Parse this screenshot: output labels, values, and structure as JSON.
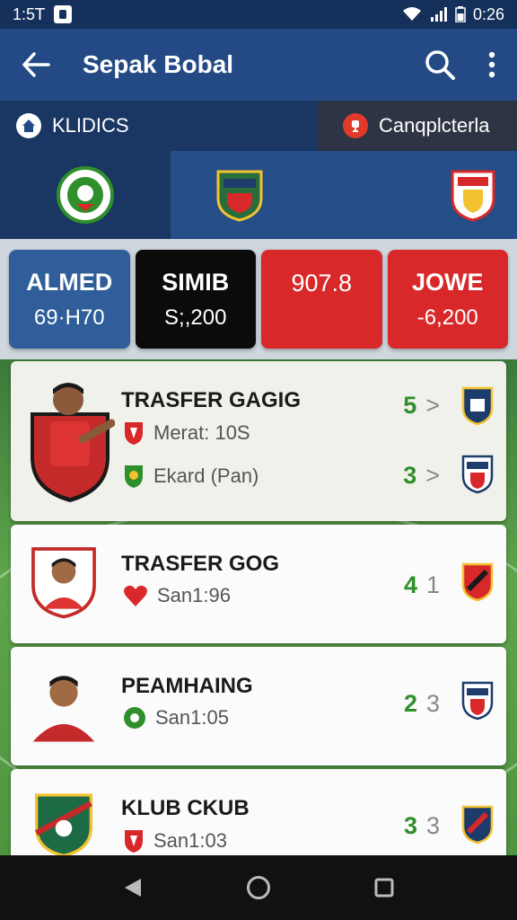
{
  "status": {
    "time": "1:5𝖳",
    "clock": "0:26"
  },
  "appbar": {
    "title": "Sepak Bobal"
  },
  "tabs": [
    {
      "label": "KLIDICS"
    },
    {
      "label": "Canqplcterla"
    }
  ],
  "scores": [
    {
      "name": "ALMED",
      "value": "69·H70",
      "color": "#2f5e9a"
    },
    {
      "name": "SIMIB",
      "value": "S;,200",
      "color": "#0b0b0b"
    },
    {
      "name": "907.8",
      "value": "",
      "color": "#d8282a"
    },
    {
      "name": "JOWE",
      "value": "-6,200",
      "color": "#d8282a"
    }
  ],
  "cards": [
    {
      "title": "TRASFER GAGIG",
      "lines": [
        {
          "icon": "shield-icon",
          "text": "Merat: 10S"
        },
        {
          "icon": "ball-shield-icon",
          "text": "Ekard (Pan)"
        }
      ],
      "stats": [
        {
          "value": "5",
          "suffix": ">"
        },
        {
          "value": "3",
          "suffix": ">"
        }
      ]
    },
    {
      "title": "TRASFER GOG",
      "lines": [
        {
          "icon": "heart-icon",
          "text": "San1:96"
        }
      ],
      "stats": [
        {
          "value": "4",
          "suffix": "1"
        }
      ]
    },
    {
      "title": "PEAMHAING",
      "lines": [
        {
          "icon": "ball-icon",
          "text": "San1:05"
        }
      ],
      "stats": [
        {
          "value": "2",
          "suffix": "3"
        }
      ]
    },
    {
      "title": "KLUB CKUB",
      "lines": [
        {
          "icon": "shield-icon",
          "text": "San1:03"
        }
      ],
      "stats": [
        {
          "value": "3",
          "suffix": "3"
        }
      ]
    }
  ],
  "colors": {
    "primary": "#234a84",
    "accent_green": "#2f8f2a",
    "accent_red": "#d8282a"
  }
}
